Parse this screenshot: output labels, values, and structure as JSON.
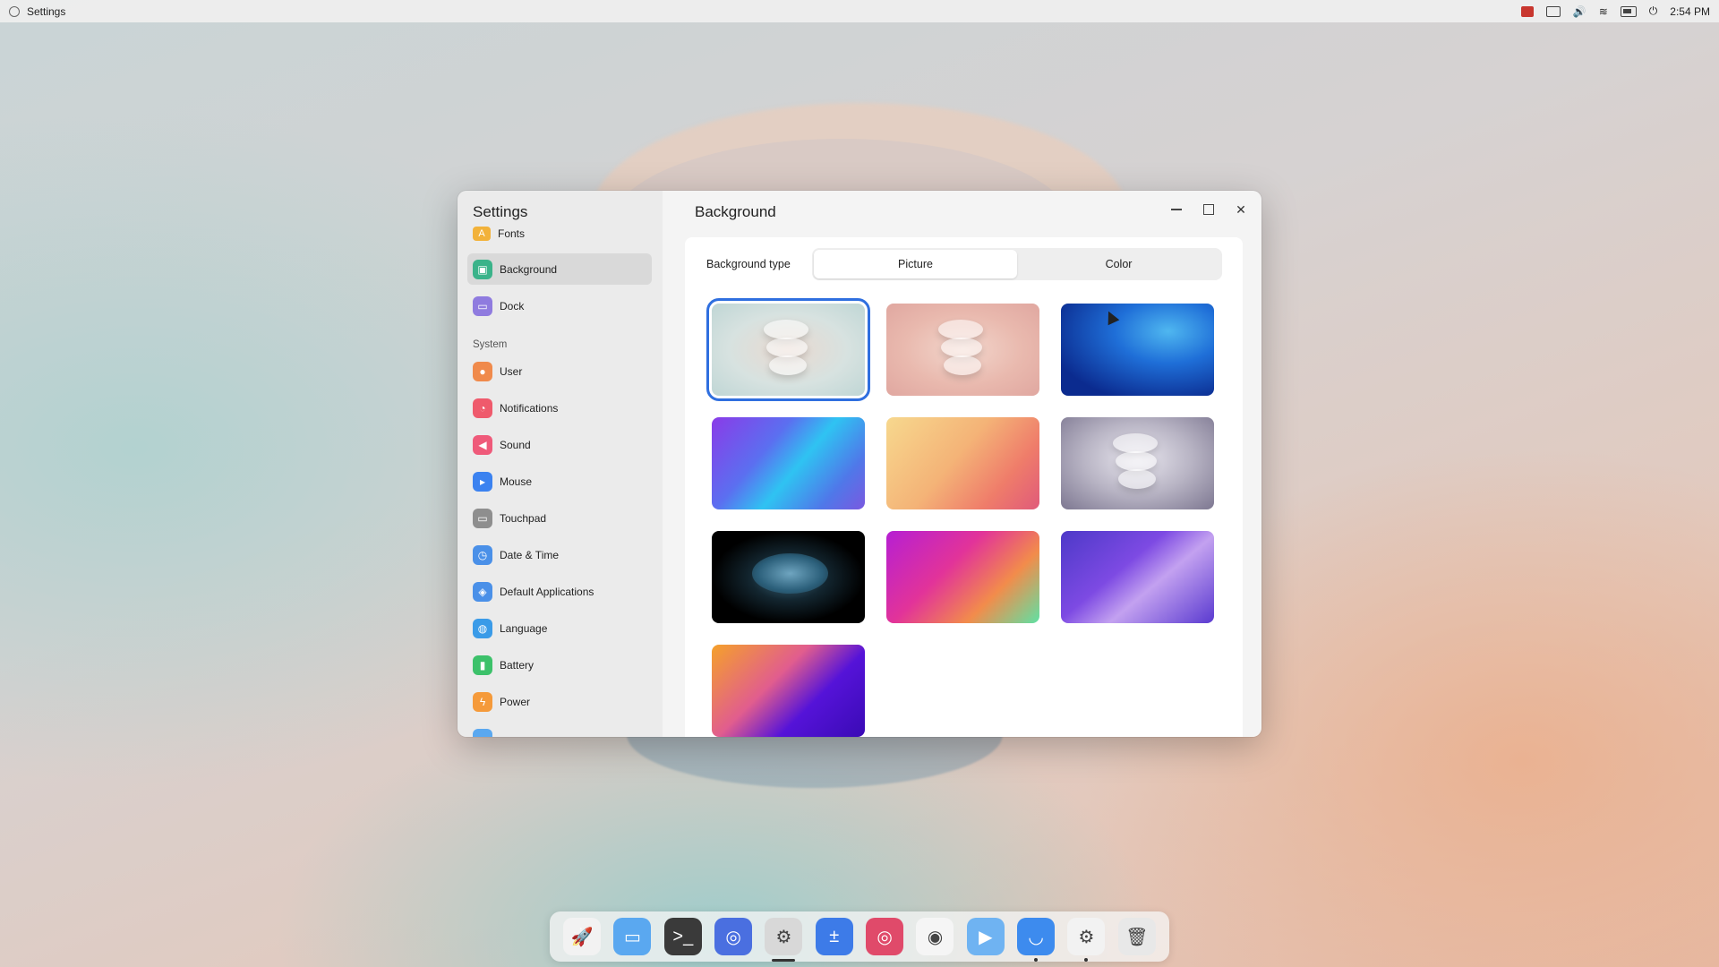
{
  "top_panel": {
    "app_name": "Settings",
    "time": "2:54 PM"
  },
  "window": {
    "sidebar_title": "Settings",
    "main_title": "Background"
  },
  "sidebar": {
    "partial_top": {
      "label": "Fonts",
      "icon": "fonts-icon",
      "color": "#f2b23a"
    },
    "items_top": [
      {
        "label": "Background",
        "icon": "background-icon",
        "color": "#3bb38a",
        "active": true
      },
      {
        "label": "Dock",
        "icon": "dock-icon",
        "color": "#8f7bdf"
      }
    ],
    "section_system": "System",
    "items_system": [
      {
        "label": "User",
        "icon": "user-icon",
        "color": "#f08a4b"
      },
      {
        "label": "Notifications",
        "icon": "notifications-icon",
        "color": "#ef5a6c"
      },
      {
        "label": "Sound",
        "icon": "sound-icon",
        "color": "#ef5a7a"
      },
      {
        "label": "Mouse",
        "icon": "mouse-icon",
        "color": "#3b82f0"
      },
      {
        "label": "Touchpad",
        "icon": "touchpad-icon",
        "color": "#8e8e8e"
      },
      {
        "label": "Date & Time",
        "icon": "clock-icon",
        "color": "#4a90e8"
      },
      {
        "label": "Default Applications",
        "icon": "default-apps-icon",
        "color": "#4a90e8"
      },
      {
        "label": "Language",
        "icon": "globe-icon",
        "color": "#3a9be8"
      },
      {
        "label": "Battery",
        "icon": "battery-icon",
        "color": "#3cc16a"
      },
      {
        "label": "Power",
        "icon": "power-icon",
        "color": "#f59a3a"
      }
    ]
  },
  "background_type": {
    "label": "Background type",
    "options": [
      "Picture",
      "Color"
    ],
    "selected": "Picture"
  },
  "wallpapers": [
    {
      "id": "t1",
      "name": "wallpaper-soft-teal-stones",
      "selected": true
    },
    {
      "id": "t2",
      "name": "wallpaper-pink-stones"
    },
    {
      "id": "t3",
      "name": "wallpaper-blue-waves"
    },
    {
      "id": "t4",
      "name": "wallpaper-purple-cyan-swirl"
    },
    {
      "id": "t5",
      "name": "wallpaper-sunset-gradient"
    },
    {
      "id": "t6",
      "name": "wallpaper-grey-stones"
    },
    {
      "id": "t7",
      "name": "wallpaper-betta-fish"
    },
    {
      "id": "t8",
      "name": "wallpaper-magenta-gradient"
    },
    {
      "id": "t9",
      "name": "wallpaper-violet-ribbon"
    },
    {
      "id": "t10",
      "name": "wallpaper-orange-violet"
    }
  ],
  "dock": [
    {
      "name": "launcher-icon",
      "color": "#f2f2f2",
      "glyph": "🚀"
    },
    {
      "name": "files-icon",
      "color": "#5aa8f0",
      "glyph": "▭"
    },
    {
      "name": "terminal-icon",
      "color": "#3a3a3a",
      "glyph": ">_"
    },
    {
      "name": "browser-icon",
      "color": "#4a6fe0",
      "glyph": "◎"
    },
    {
      "name": "settings-icon",
      "color": "#d8d8d8",
      "glyph": "⚙",
      "running": "wide"
    },
    {
      "name": "calculator-icon",
      "color": "#3d7be8",
      "glyph": "±"
    },
    {
      "name": "debian-icon",
      "color": "#e04a6a",
      "glyph": "◎"
    },
    {
      "name": "screenshot-icon",
      "color": "#f5f5f5",
      "glyph": "◉"
    },
    {
      "name": "media-player-icon",
      "color": "#6fb3f2",
      "glyph": "▶"
    },
    {
      "name": "app-store-icon",
      "color": "#3d8bee",
      "glyph": "◡",
      "running": "dot"
    },
    {
      "name": "system-settings-icon",
      "color": "#f2f2f2",
      "glyph": "⚙",
      "running": "dot"
    },
    {
      "name": "trash-icon",
      "color": "#e8e8e8",
      "glyph": "🗑"
    }
  ]
}
